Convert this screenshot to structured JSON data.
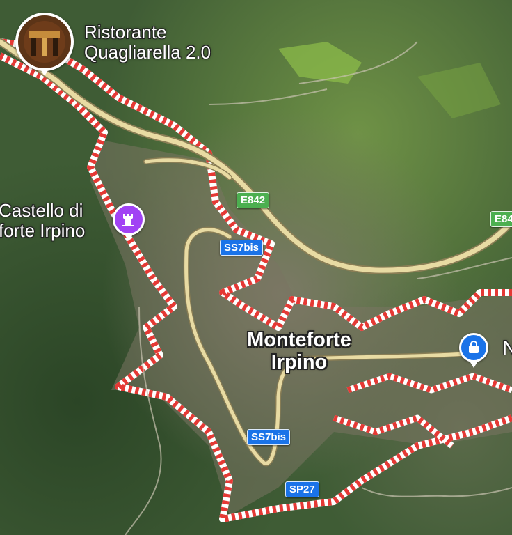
{
  "places": {
    "restaurant": {
      "name_line1": "Ristorante",
      "name_line2": "Quagliarella 2.0",
      "icon": "restaurant-photo-icon"
    },
    "castle": {
      "name_line1": "Castello di",
      "name_line2": "forte Irpino",
      "icon": "castle-icon",
      "color": "#a142f4"
    },
    "town": {
      "line1": "Monteforte",
      "line2": "Irpino"
    },
    "shop": {
      "name": "N",
      "icon": "shopping-bag-icon",
      "color": "#1a73e8"
    }
  },
  "roads": {
    "e842_a": "E842",
    "e842_b": "E84",
    "ss7bis_a": "SS7bis",
    "ss7bis_b": "SS7bis",
    "sp27": "SP27"
  },
  "colors": {
    "boundary_red": "#e53935",
    "road_fill": "#e8dba3",
    "road_edge": "#8a7e55",
    "forest_dark": "#2f4a2a",
    "forest_light": "#5d7d3a"
  }
}
